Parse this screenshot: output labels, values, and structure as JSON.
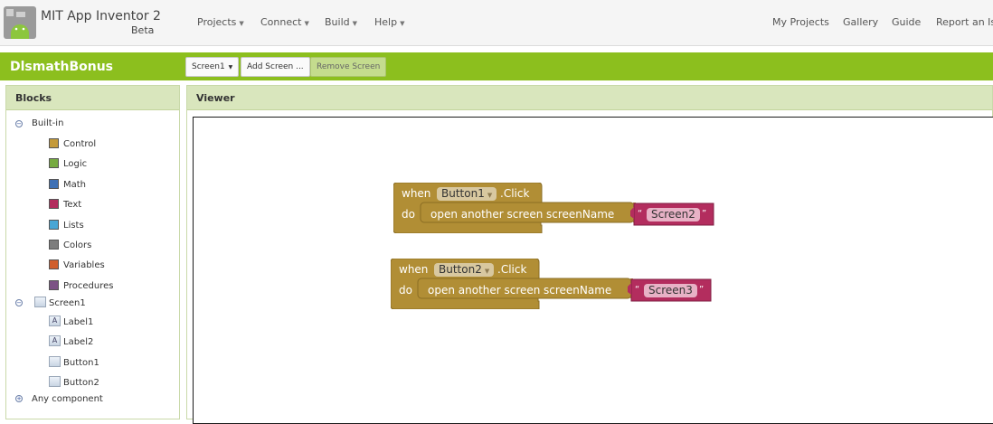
{
  "app": {
    "title": "MIT App Inventor 2",
    "subtitle": "Beta"
  },
  "menu": {
    "projects": "Projects",
    "connect": "Connect",
    "build": "Build",
    "help": "Help"
  },
  "right_nav": {
    "my_projects": "My Projects",
    "gallery": "Gallery",
    "guide": "Guide",
    "report": "Report an Iss"
  },
  "toolbar": {
    "project_name": "DlsmathBonus",
    "screen_select": "Screen1",
    "add_screen": "Add Screen ...",
    "remove_screen": "Remove Screen"
  },
  "blocks_panel": {
    "header": "Blocks",
    "builtin_label": "Built-in",
    "builtins": [
      {
        "label": "Control",
        "color": "#c49a3a"
      },
      {
        "label": "Logic",
        "color": "#77ab41"
      },
      {
        "label": "Math",
        "color": "#3f71b5"
      },
      {
        "label": "Text",
        "color": "#b32d5e"
      },
      {
        "label": "Lists",
        "color": "#49a6d4"
      },
      {
        "label": "Colors",
        "color": "#7d7d7d"
      },
      {
        "label": "Variables",
        "color": "#d05f2d"
      },
      {
        "label": "Procedures",
        "color": "#7c5385"
      }
    ],
    "screen_label": "Screen1",
    "components": [
      {
        "label": "Label1",
        "icon": "label-icon"
      },
      {
        "label": "Label2",
        "icon": "label-icon"
      },
      {
        "label": "Button1",
        "icon": "button-icon"
      },
      {
        "label": "Button2",
        "icon": "button-icon"
      }
    ],
    "any_component": "Any component"
  },
  "viewer": {
    "header": "Viewer",
    "blocks": [
      {
        "when": "when",
        "component": "Button1",
        "event": ".Click",
        "do": "do",
        "call": "open another screen",
        "param": "screenName",
        "open_quote": "“",
        "value": "Screen2",
        "close_quote": "”"
      },
      {
        "when": "when",
        "component": "Button2",
        "event": ".Click",
        "do": "do",
        "call": "open another screen",
        "param": "screenName",
        "open_quote": "“",
        "value": "Screen3",
        "close_quote": "”"
      }
    ]
  },
  "colors": {
    "green_bar": "#8cbf1e",
    "event_block": "#b18e35",
    "text_block": "#b32d5e"
  }
}
